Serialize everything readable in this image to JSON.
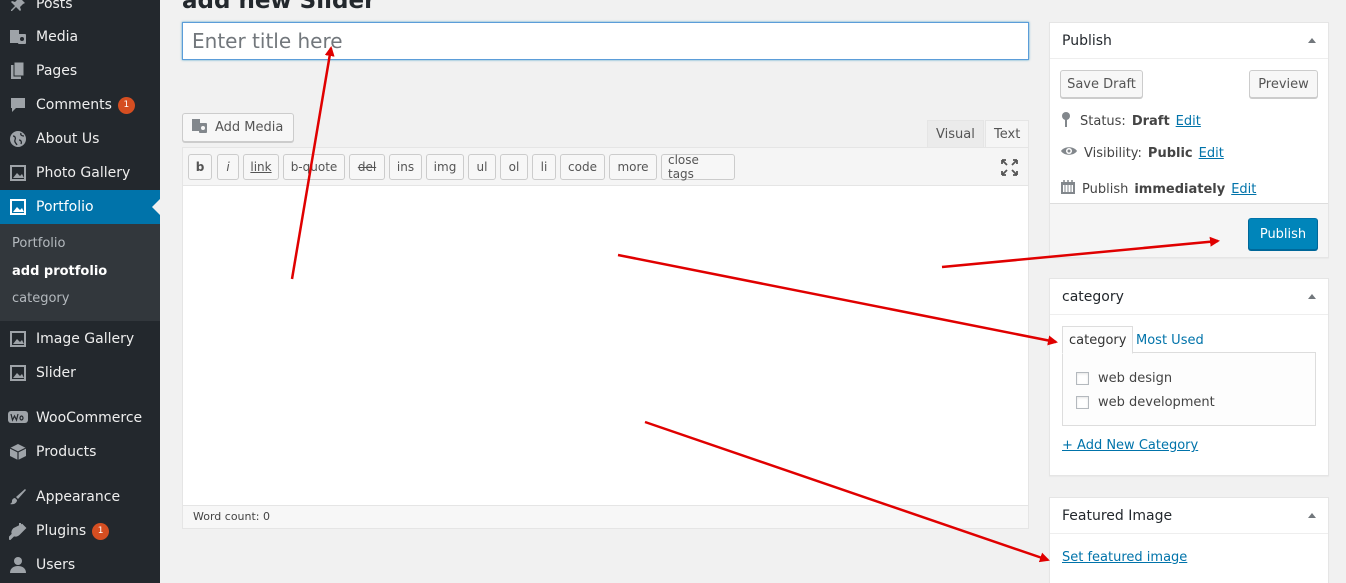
{
  "sidebar": {
    "items": [
      {
        "label": "Posts",
        "icon": "pin-icon"
      },
      {
        "label": "Media",
        "icon": "media-icon"
      },
      {
        "label": "Pages",
        "icon": "pages-icon"
      },
      {
        "label": "Comments",
        "icon": "comment-icon",
        "badge": "1"
      },
      {
        "label": "About Us",
        "icon": "globe-icon"
      },
      {
        "label": "Photo Gallery",
        "icon": "gallery-icon"
      },
      {
        "label": "Portfolio",
        "icon": "gallery-icon"
      },
      {
        "label": "Image Gallery",
        "icon": "gallery-icon"
      },
      {
        "label": "Slider",
        "icon": "gallery-icon"
      },
      {
        "label": "WooCommerce",
        "icon": "woo-icon"
      },
      {
        "label": "Products",
        "icon": "box-icon"
      },
      {
        "label": "Appearance",
        "icon": "brush-icon"
      },
      {
        "label": "Plugins",
        "icon": "plugin-icon",
        "badge": "1"
      },
      {
        "label": "Users",
        "icon": "user-icon"
      }
    ],
    "submenu": [
      "Portfolio",
      "add protfolio",
      "category"
    ]
  },
  "header": {
    "title": "add new Slider"
  },
  "title_field": {
    "placeholder": "Enter title here",
    "value": ""
  },
  "editor": {
    "add_media_label": "Add Media",
    "tabs": [
      "Visual",
      "Text"
    ],
    "quicktags": [
      "b",
      "i",
      "link",
      "b-quote",
      "del",
      "ins",
      "img",
      "ul",
      "ol",
      "li",
      "code",
      "more",
      "close tags"
    ],
    "word_count": "Word count: 0"
  },
  "publish_box": {
    "title": "Publish",
    "save_draft": "Save Draft",
    "preview": "Preview",
    "status_label": "Status:",
    "status_value": "Draft",
    "visibility_label": "Visibility:",
    "visibility_value": "Public",
    "publish_label": "Publish",
    "publish_value": "immediately",
    "edit": "Edit",
    "publish_button": "Publish"
  },
  "category_box": {
    "title": "category",
    "tabs": [
      "category",
      "Most Used"
    ],
    "items": [
      "web design",
      "web development"
    ],
    "add_new": "+ Add New Category"
  },
  "featured_box": {
    "title": "Featured Image",
    "link": "Set featured image"
  },
  "colors": {
    "sidebar_bg": "#23282d",
    "active_bg": "#0073aa",
    "primary_button": "#0085ba",
    "link": "#0073aa",
    "annotation_arrow": "#e00000"
  }
}
